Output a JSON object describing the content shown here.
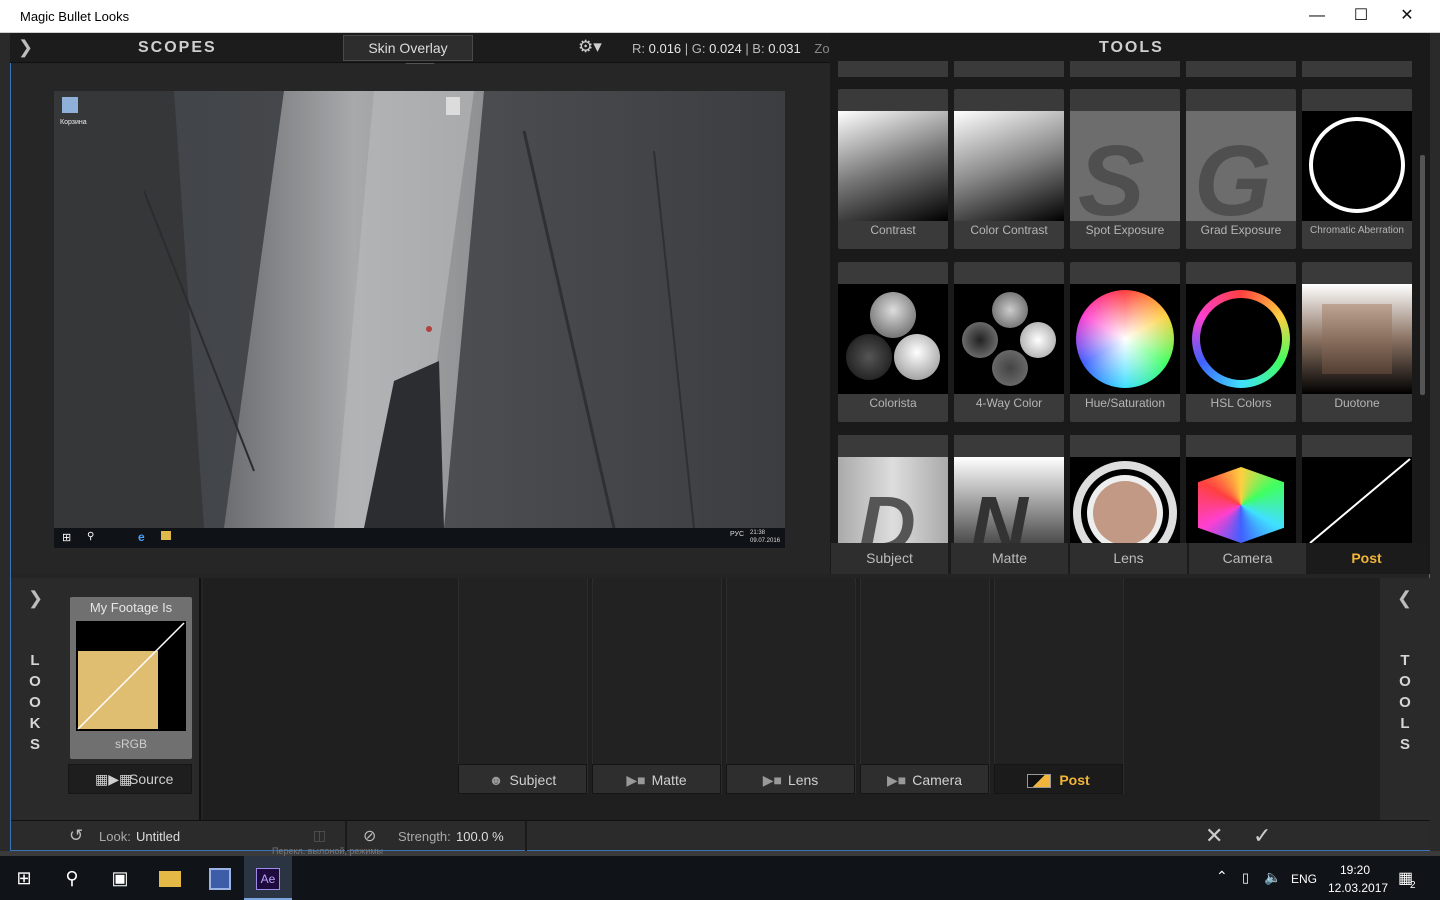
{
  "window": {
    "title": "Magic Bullet Looks"
  },
  "scopes": {
    "title": "SCOPES",
    "overlay_button": "Skin Overlay",
    "readout_r_label": "R:",
    "readout_r": "0.016",
    "readout_g_label": "| G:",
    "readout_g": "0.024",
    "readout_b_label": "| B:",
    "readout_b": "0.031",
    "zoom_partial": "Zo"
  },
  "preview": {
    "desktop_icon_1": "Корзина",
    "desktop_icon_2": "",
    "clock_time": "21:38",
    "clock_date": "09.07.2016",
    "lang": "РУС"
  },
  "tools": {
    "title": "TOOLS",
    "row1": [
      "Contrast",
      "Color Contrast",
      "Spot Exposure",
      "Grad Exposure",
      "Chromatic Aberration"
    ],
    "row2": [
      "Colorista",
      "4-Way Color",
      "Hue/Saturation",
      "HSL Colors",
      "Duotone"
    ],
    "tabs": [
      "Subject",
      "Matte",
      "Lens",
      "Camera",
      "Post"
    ]
  },
  "looks": {
    "vertical_label": [
      "L",
      "O",
      "O",
      "K",
      "S"
    ],
    "card_title": "My Footage Is",
    "card_sub": "sRGB",
    "source_button": "Source"
  },
  "tools_side": {
    "vertical_label": [
      "T",
      "O",
      "O",
      "L",
      "S"
    ]
  },
  "chain": {
    "buttons": [
      "Subject",
      "Matte",
      "Lens",
      "Camera",
      "Post"
    ]
  },
  "status": {
    "look_label": "Look:",
    "look_value": "Untitled",
    "strength_label": "Strength:",
    "strength_value": "100.0 %"
  },
  "taskbar": {
    "lang": "ENG",
    "time": "19:20",
    "date": "12.03.2017",
    "notif_count": "2",
    "app_label": "Ae",
    "behind_text": "Перекл. вылоной, режимы"
  },
  "colors": {
    "accent_post": "#f0b53a",
    "window_border": "#3a74b8",
    "source_swatch": "#dfbe72"
  }
}
